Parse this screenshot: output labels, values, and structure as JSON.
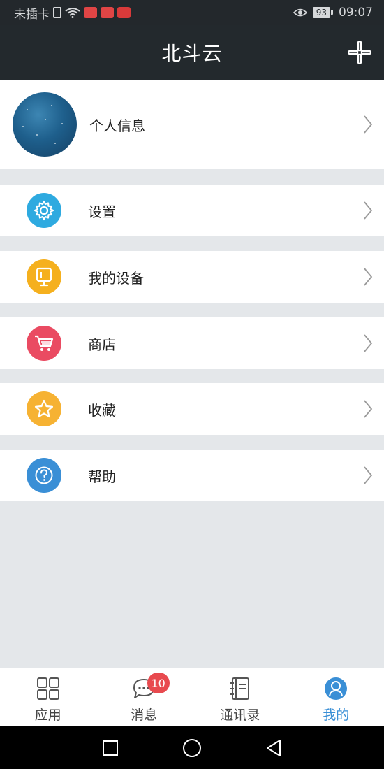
{
  "status_bar": {
    "carrier": "未插卡",
    "battery": "93",
    "time": "09:07",
    "icons": [
      "sim-icon",
      "wifi-icon",
      "app-icon-red-1",
      "app-icon-red-2",
      "app-icon-red-3",
      "eye-icon",
      "battery-icon"
    ]
  },
  "header": {
    "title": "北斗云",
    "action_icon": "plus-icon"
  },
  "profile": {
    "label": "个人信息",
    "avatar": "avatar-starry-sky"
  },
  "menu": [
    {
      "label": "设置",
      "icon": "gear-icon",
      "color": "#2eaae0"
    },
    {
      "label": "我的设备",
      "icon": "monitor-icon",
      "color": "#f5b01e"
    },
    {
      "label": "商店",
      "icon": "cart-icon",
      "color": "#ea4b62"
    },
    {
      "label": "收藏",
      "icon": "star-icon",
      "color": "#f6b233"
    },
    {
      "label": "帮助",
      "icon": "help-icon",
      "color": "#3a8fd6"
    }
  ],
  "tabs": [
    {
      "label": "应用",
      "icon": "grid-icon",
      "active": false
    },
    {
      "label": "消息",
      "icon": "message-icon",
      "active": false,
      "badge": "10"
    },
    {
      "label": "通讯录",
      "icon": "contacts-icon",
      "active": false
    },
    {
      "label": "我的",
      "icon": "user-icon",
      "active": true
    }
  ],
  "colors": {
    "header_bg": "#23292d",
    "page_bg": "#e4e7ea",
    "active_tab": "#3a8fd6",
    "badge": "#e84a4f"
  }
}
